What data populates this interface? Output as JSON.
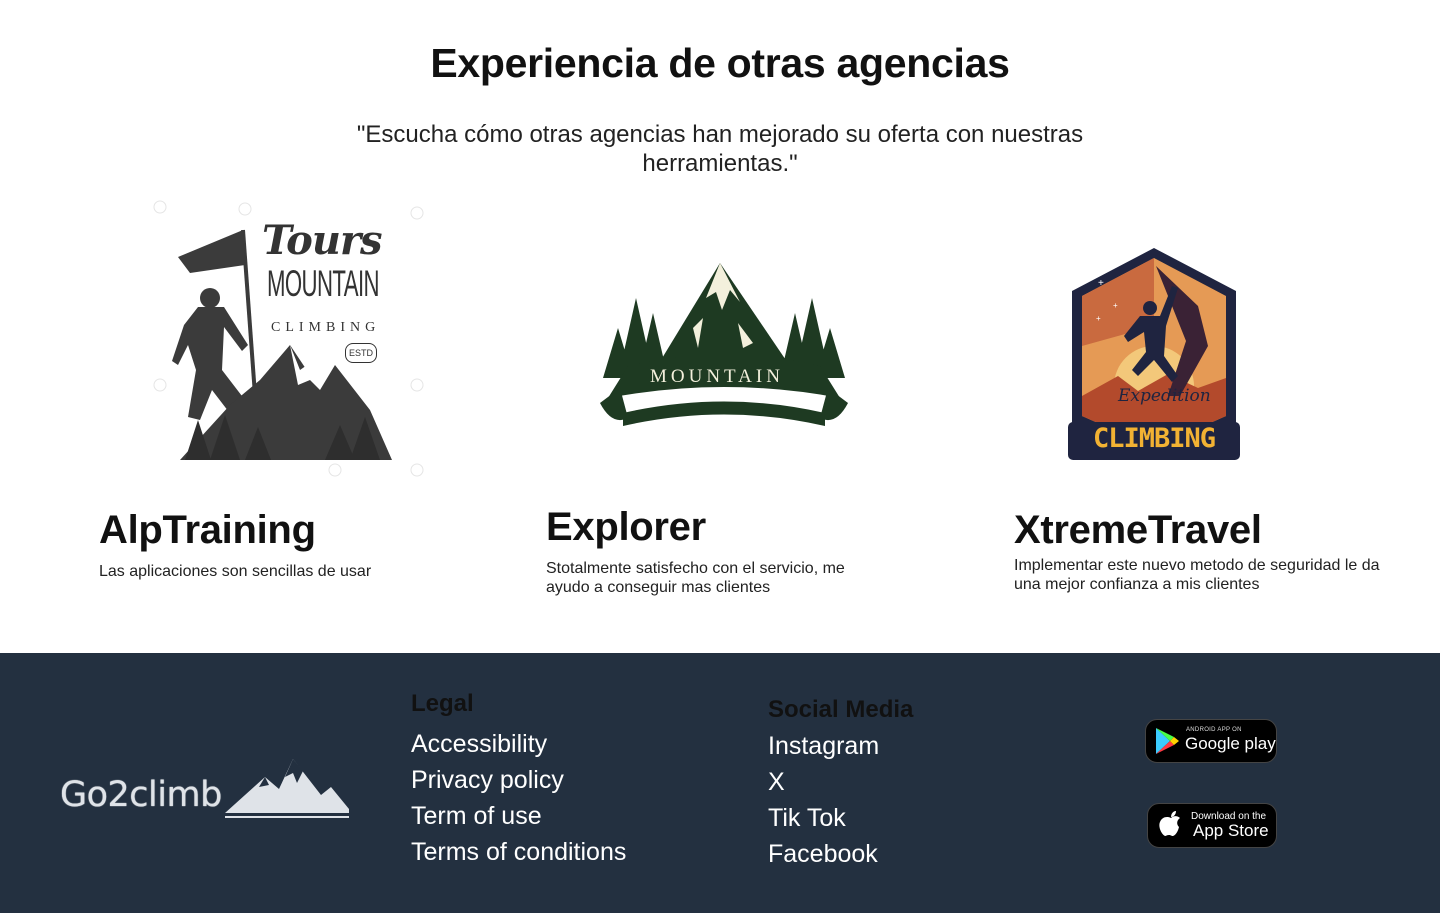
{
  "header": {
    "title": "Experiencia de otras agencias",
    "subtitle": "\"Escucha cómo otras agencias han mejorado su oferta con nuestras herramientas.\""
  },
  "testimonials": [
    {
      "name": "AlpTraining",
      "text": "Las aplicaciones son sencillas de usar",
      "logo": {
        "script": "Tours",
        "word": "MOUNTAIN",
        "arc": "CLIMBING",
        "seal": "ESTD"
      }
    },
    {
      "name": "Explorer",
      "text": "Stotalmente satisfecho con el servicio, me ayudo a conseguir mas clientes",
      "logo": {
        "banner": "MOUNTAIN"
      }
    },
    {
      "name": "XtremeTravel",
      "text": "Implementar este nuevo metodo de seguridad le da una mejor confianza a mis clientes",
      "logo": {
        "script": "Expedition",
        "word": "CLIMBING"
      }
    }
  ],
  "footer": {
    "brand": "Go2climb",
    "legal": {
      "title": "Legal",
      "links": [
        "Accessibility",
        "Privacy policy",
        "Term of use",
        "Terms of conditions"
      ]
    },
    "social": {
      "title": "Social Media",
      "links": [
        "Instagram",
        "X",
        "Tik Tok",
        "Facebook"
      ]
    },
    "badges": {
      "google": {
        "small": "ANDROID APP ON",
        "big": "Google play"
      },
      "apple": {
        "small": "Download on the",
        "big": "App Store"
      }
    }
  },
  "colors": {
    "footer_bg": "#233040",
    "explorer_green": "#1e3a22",
    "xtreme_orange": "#e59a55",
    "xtreme_navy": "#1f2440",
    "climbing_yellow": "#f2b233"
  }
}
